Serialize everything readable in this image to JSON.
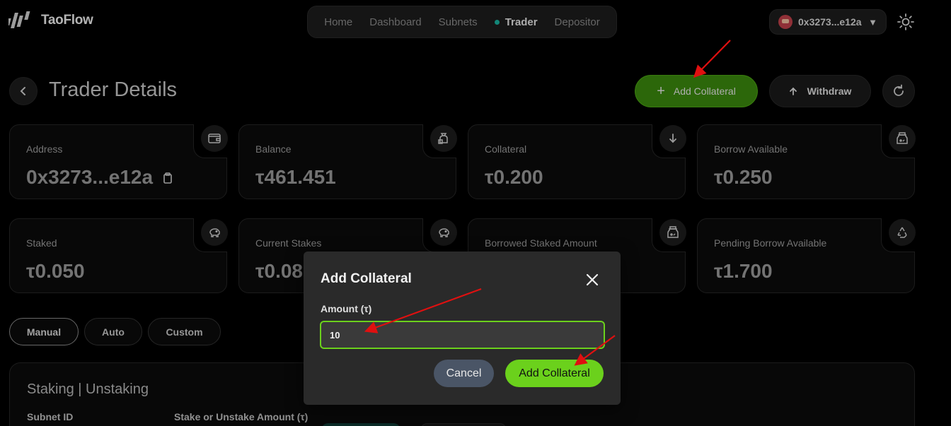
{
  "header": {
    "brand": "TaoFlow",
    "nav": [
      {
        "label": "Home",
        "active": false
      },
      {
        "label": "Dashboard",
        "active": false
      },
      {
        "label": "Subnets",
        "active": false
      },
      {
        "label": "Trader",
        "active": true
      },
      {
        "label": "Depositor",
        "active": false
      }
    ],
    "wallet_address": "0x3273...e12a",
    "theme_icon": "sun-icon"
  },
  "page": {
    "title": "Trader Details",
    "back_icon": "chevron-left-icon",
    "add_collateral_label": "Add Collateral",
    "withdraw_label": "Withdraw",
    "refresh_icon": "refresh-icon"
  },
  "stats": [
    {
      "label": "Address",
      "value": "0x3273...e12a",
      "icon": "wallet-icon"
    },
    {
      "label": "Balance",
      "value": "τ461.451",
      "icon": "money-bag-icon"
    },
    {
      "label": "Collateral",
      "value": "τ0.200",
      "icon": "arrow-down-icon"
    },
    {
      "label": "Borrow Available",
      "value": "τ0.250",
      "icon": "jar-icon"
    },
    {
      "label": "Staked",
      "value": "τ0.050",
      "icon": "piggy-bank-icon"
    },
    {
      "label": "Current Stakes",
      "value": "τ0.08",
      "icon": "piggy-bank-icon"
    },
    {
      "label": "Borrowed Staked Amount",
      "value": "",
      "icon": "jar-icon"
    },
    {
      "label": "Pending Borrow Available",
      "value": "τ1.700",
      "icon": "recycle-icon"
    }
  ],
  "modes": [
    {
      "label": "Manual",
      "active": true
    },
    {
      "label": "Auto",
      "active": false
    },
    {
      "label": "Custom",
      "active": false
    }
  ],
  "staking": {
    "title": "Staking | Unstaking",
    "subnet_label": "Subnet ID",
    "amount_label": "Stake or Unstake Amount (τ)"
  },
  "modal": {
    "title": "Add Collateral",
    "amount_label": "Amount (τ)",
    "amount_value": "10",
    "cancel_label": "Cancel",
    "confirm_label": "Add Collateral"
  },
  "colors": {
    "accent_green": "#6bd11c",
    "dark_green": "#3b8a0e",
    "teal_dot": "#19b3a0",
    "annotation_red": "#e01010"
  }
}
